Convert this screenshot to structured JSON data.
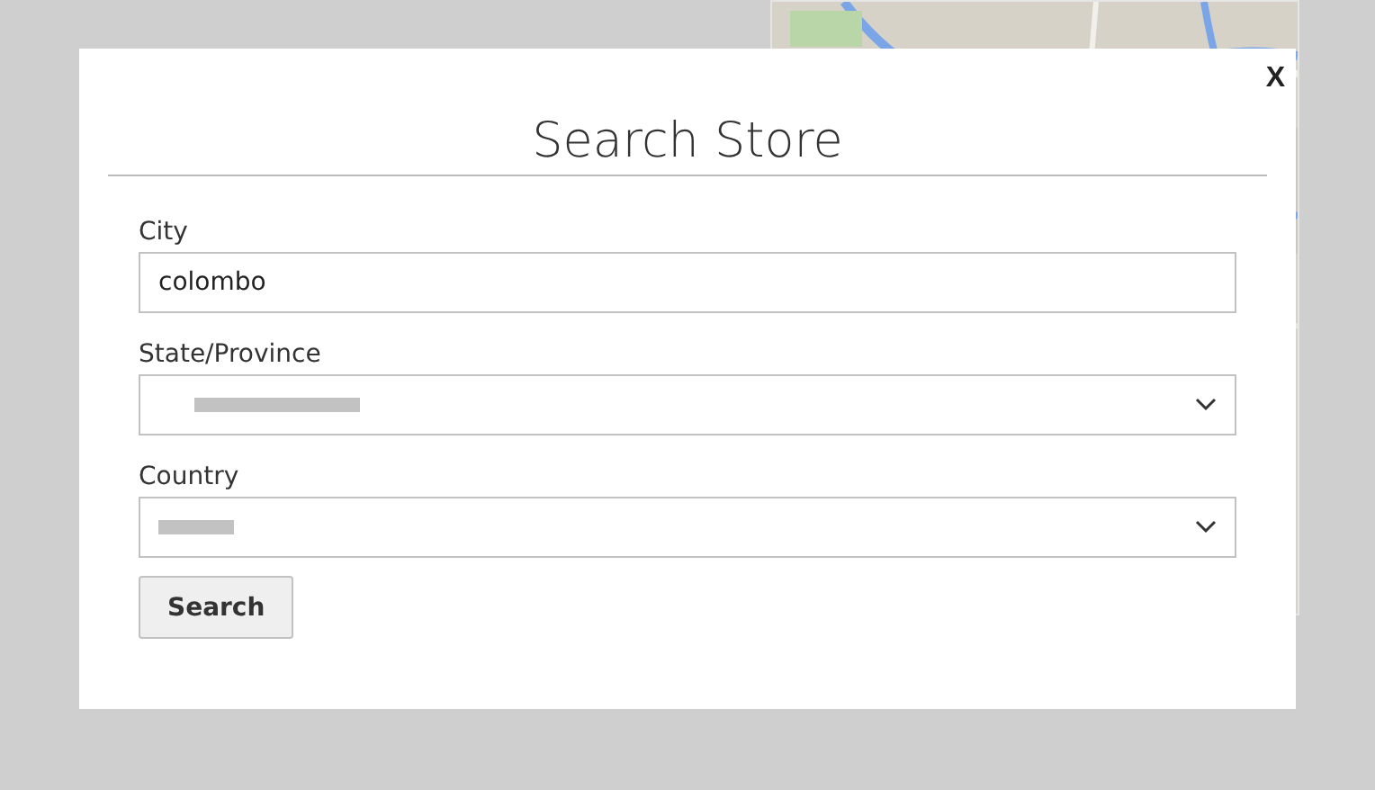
{
  "dialog": {
    "close": "X",
    "title": "Search Store",
    "fields": [
      {
        "kind": "input",
        "label": "City",
        "value": "colombo"
      },
      {
        "kind": "select",
        "label": "State/Province",
        "redacted": true
      },
      {
        "kind": "select",
        "label": "Country",
        "redacted": true
      }
    ],
    "button": "Search"
  }
}
